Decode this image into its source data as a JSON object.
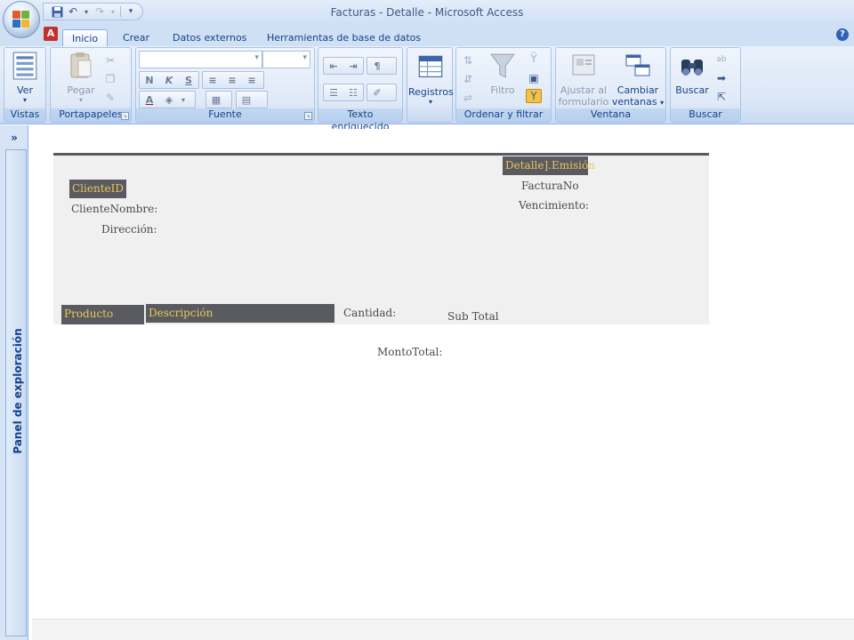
{
  "window": {
    "title": "Facturas - Detalle - Microsoft Access"
  },
  "ribbon_tabs": [
    "Inicio",
    "Crear",
    "Datos externos",
    "Herramientas de base de datos"
  ],
  "groups": {
    "vistas": {
      "label": "Vistas",
      "ver": "Ver"
    },
    "portapapeles": {
      "label": "Portapapeles",
      "pegar": "Pegar"
    },
    "fuente": {
      "label": "Fuente",
      "bold": "N",
      "italic": "K",
      "underline": "S"
    },
    "texto": {
      "label": "Texto enriquecido"
    },
    "registros": {
      "label": "Registros"
    },
    "ordenar": {
      "label": "Ordenar y filtrar",
      "filtro": "Filtro"
    },
    "ventana": {
      "label": "Ventana",
      "ajustar_1": "Ajustar al",
      "ajustar_2": "formulario",
      "cambiar_1": "Cambiar",
      "cambiar_2": "ventanas"
    },
    "buscar": {
      "label": "Buscar",
      "buscar_btn": "Buscar"
    }
  },
  "nav_pane": {
    "label": "Panel de exploración",
    "toggle": "»"
  },
  "report": {
    "emision": "Detalle].Emisión",
    "cliente_id": "ClienteID",
    "cliente_nombre": "ClienteNombre:",
    "direccion": "Dirección:",
    "factura_no": "FacturaNo",
    "vencimiento": "Vencimiento:",
    "producto": "Producto",
    "descripcion": "Descripción",
    "cantidad": "Cantidad:",
    "sub_total": "Sub Total",
    "monto_total": "MontoTotal:"
  }
}
